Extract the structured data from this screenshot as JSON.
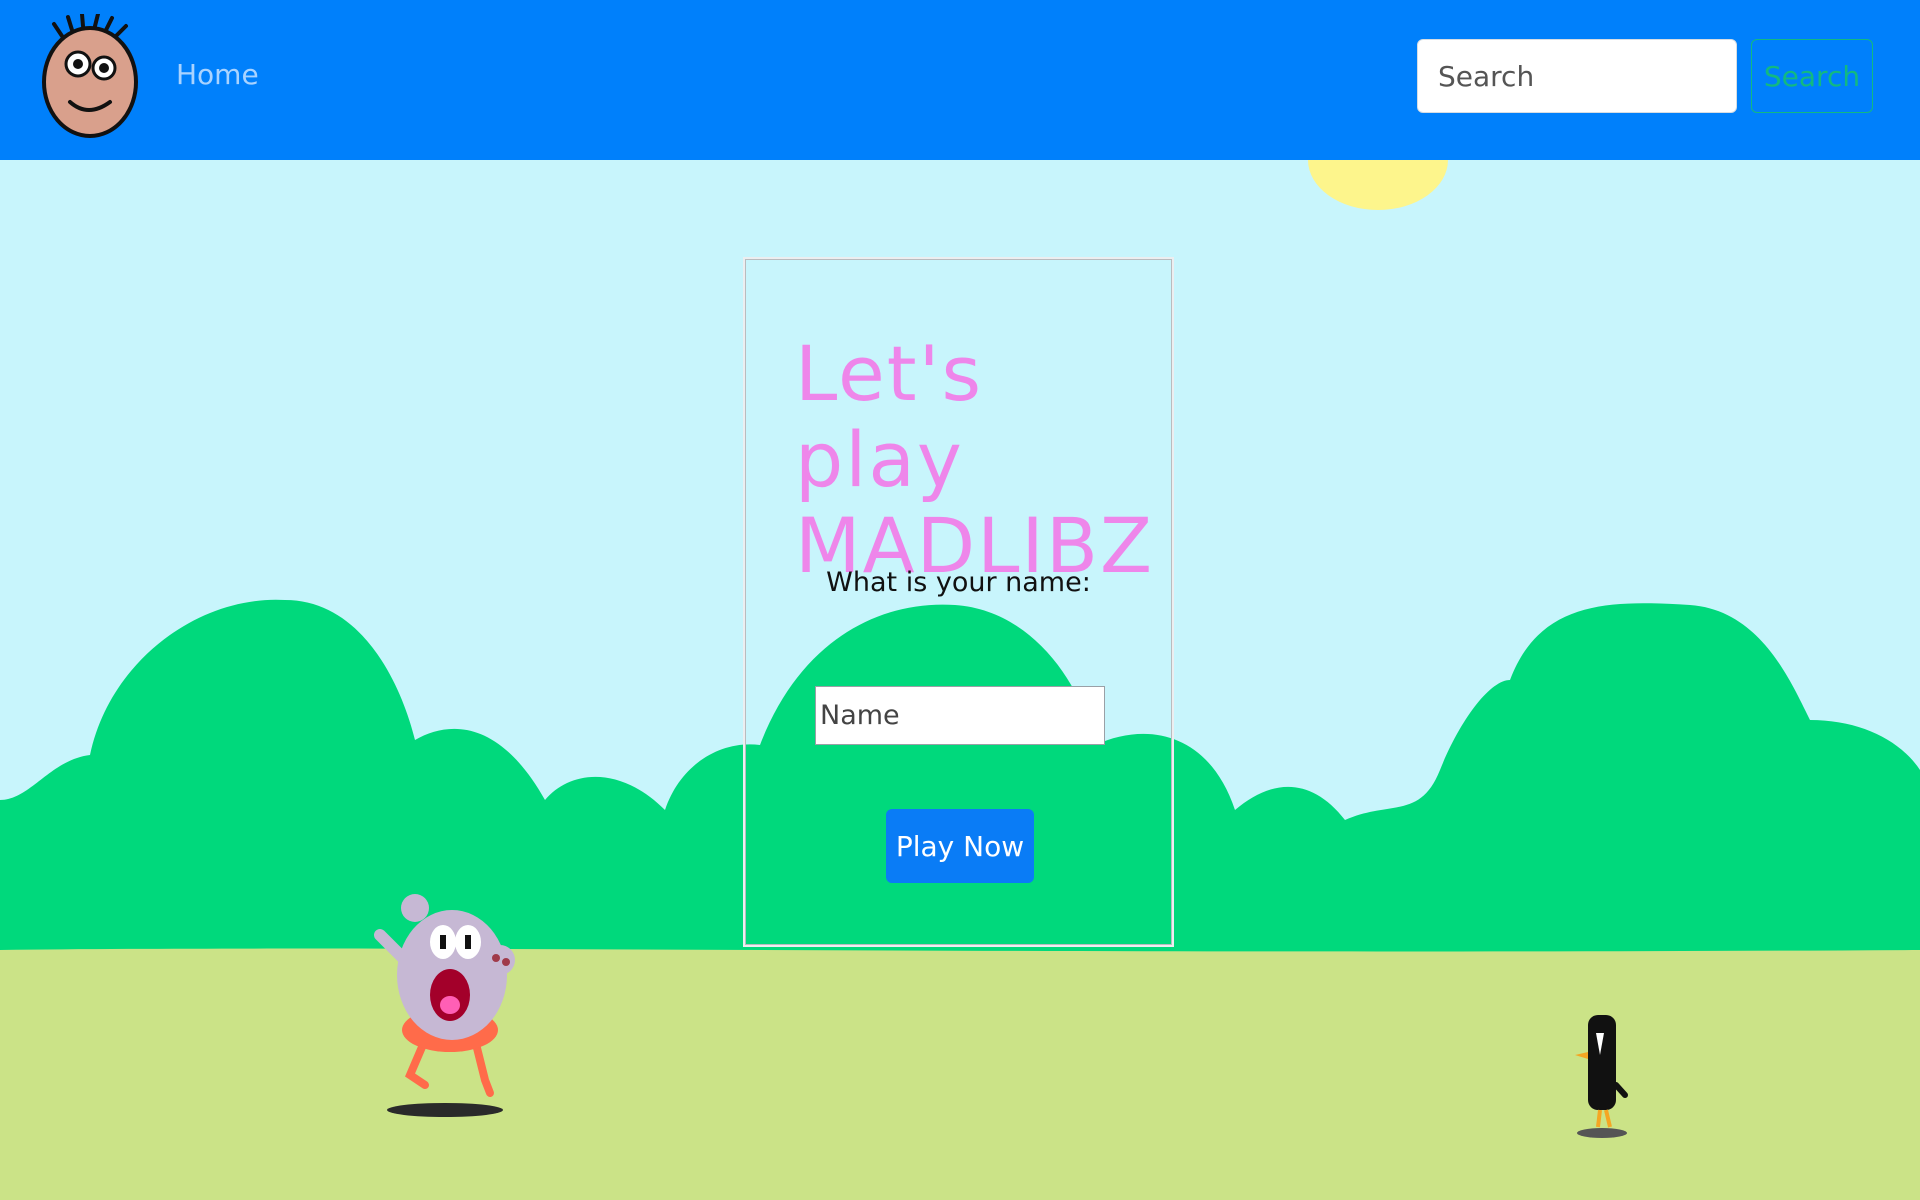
{
  "navbar": {
    "logo_icon": "cartoon-face-icon",
    "home_label": "Home",
    "search_placeholder": "Search",
    "search_button_label": "Search",
    "background_color": "#0080fb",
    "search_button_color": "#12b981"
  },
  "card": {
    "title": "Let's play MADLIBZ",
    "title_color": "#ee86ea",
    "name_prompt": "What is your name:",
    "name_placeholder": "Name",
    "play_button_label": "Play Now",
    "play_button_color": "#0a7cf6"
  },
  "scene": {
    "sky_color": "#c8f5fc",
    "hill_color": "#00d97c",
    "ground_color": "#cbe387",
    "sun_color": "#fdf58c",
    "characters": [
      "running-monster-icon",
      "penguin-icon"
    ]
  }
}
